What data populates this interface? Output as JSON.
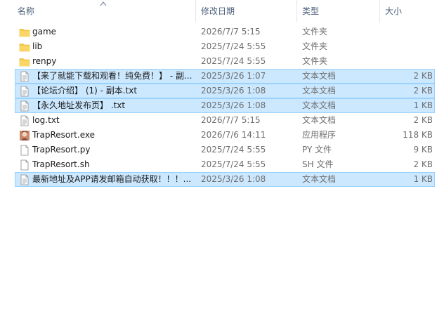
{
  "columns": {
    "name": "名称",
    "date": "修改日期",
    "type": "类型",
    "size": "大小"
  },
  "colors": {
    "selected_bg": "#cce8ff",
    "selected_border": "#99d1ff",
    "folder": "#f7c948",
    "header_text": "#4c607a"
  },
  "files": [
    {
      "name": "game",
      "date": "2026/7/7 5:15",
      "type": "文件夹",
      "size": "",
      "icon": "folder-icon",
      "selected": false
    },
    {
      "name": "lib",
      "date": "2025/7/24 5:55",
      "type": "文件夹",
      "size": "",
      "icon": "folder-icon",
      "selected": false
    },
    {
      "name": "renpy",
      "date": "2025/7/24 5:55",
      "type": "文件夹",
      "size": "",
      "icon": "folder-icon",
      "selected": false
    },
    {
      "name": "【来了就能下载和观看！纯免费！】 - 副...",
      "date": "2025/3/26 1:07",
      "type": "文本文档",
      "size": "2 KB",
      "icon": "text-file-icon",
      "selected": true
    },
    {
      "name": "【论坛介绍】 (1) - 副本.txt",
      "date": "2025/3/26 1:08",
      "type": "文本文档",
      "size": "2 KB",
      "icon": "text-file-icon",
      "selected": true
    },
    {
      "name": "【永久地址发布页】 .txt",
      "date": "2025/3/26 1:08",
      "type": "文本文档",
      "size": "1 KB",
      "icon": "text-file-icon",
      "selected": true
    },
    {
      "name": "log.txt",
      "date": "2026/7/7 5:15",
      "type": "文本文档",
      "size": "2 KB",
      "icon": "text-file-icon",
      "selected": false
    },
    {
      "name": "TrapResort.exe",
      "date": "2026/7/6 14:11",
      "type": "应用程序",
      "size": "118 KB",
      "icon": "app-icon",
      "selected": false
    },
    {
      "name": "TrapResort.py",
      "date": "2025/7/24 5:55",
      "type": "PY 文件",
      "size": "9 KB",
      "icon": "blank-file-icon",
      "selected": false
    },
    {
      "name": "TrapResort.sh",
      "date": "2025/7/24 5:55",
      "type": "SH 文件",
      "size": "2 KB",
      "icon": "blank-file-icon",
      "selected": false
    },
    {
      "name": "最新地址及APP请发邮箱自动获取！！！...",
      "date": "2025/3/26 1:08",
      "type": "文本文档",
      "size": "1 KB",
      "icon": "text-file-icon",
      "selected": true
    }
  ]
}
